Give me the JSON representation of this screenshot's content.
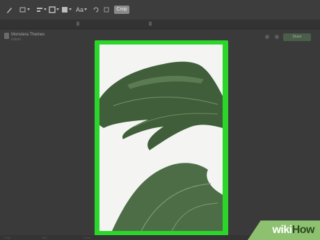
{
  "toolbar": {
    "tools": [
      "markup-icon",
      "shape-icon",
      "align-icon",
      "border-color-icon",
      "fill-color-icon",
      "text-style-icon",
      "rotate-icon",
      "adjust-icon"
    ],
    "text_style_label": "Aa",
    "crop_label": "Crop"
  },
  "document": {
    "title": "Monstera Themes",
    "subtitle": "Edited"
  },
  "header": {
    "share_label": "Share"
  },
  "footer": {
    "labels": [
      "Page",
      "Size",
      "Zoom"
    ]
  },
  "watermark": {
    "part1": "wiki",
    "part2": "How"
  },
  "colors": {
    "selection_border": "#2ad62a",
    "leaf_dark": "#3b5a36",
    "leaf_mid": "#587a50"
  }
}
